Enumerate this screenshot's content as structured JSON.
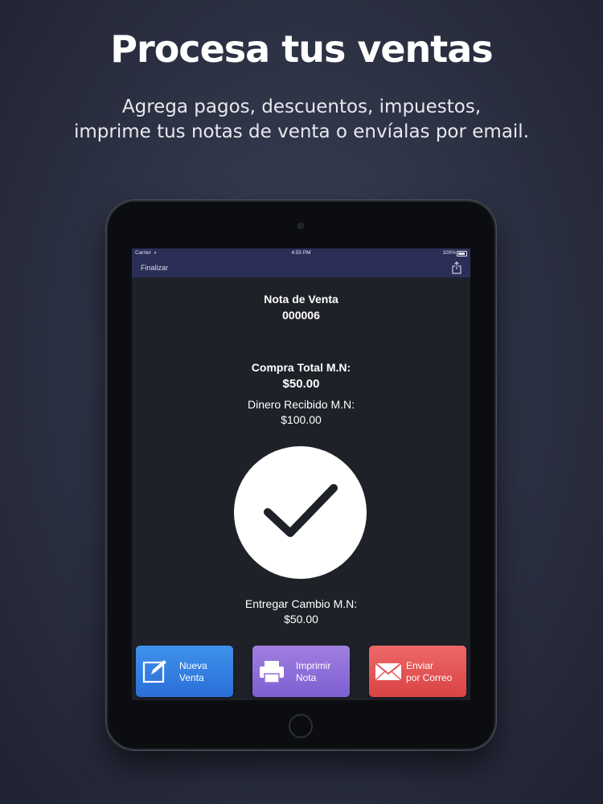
{
  "headline": "Procesa tus ventas",
  "subline": [
    "Agrega pagos, descuentos, impuestos,",
    "imprime tus notas de venta o envíalas por email."
  ],
  "statusbar": {
    "carrier": "Carrier",
    "time": "4:55 PM",
    "battery": "100%"
  },
  "navbar": {
    "left_label": "Finalizar",
    "share_icon": "share-icon"
  },
  "receipt": {
    "title": "Nota de Venta",
    "number": "000006",
    "total_label": "Compra Total M.N:",
    "total_value": "$50.00",
    "received_label": "Dinero Recibido M.N:",
    "received_value": "$100.00",
    "change_label": "Entregar Cambio M.N:",
    "change_value": "$50.00"
  },
  "buttons": [
    {
      "line1": "Nueva",
      "line2": "Venta",
      "icon": "edit-icon",
      "color": "#2f7fe0"
    },
    {
      "line1": "Imprimir",
      "line2": "Nota",
      "icon": "printer-icon",
      "color": "#8f6fd9"
    },
    {
      "line1": "Enviar",
      "line2": "por Correo",
      "icon": "mail-icon",
      "color": "#e35555"
    }
  ]
}
